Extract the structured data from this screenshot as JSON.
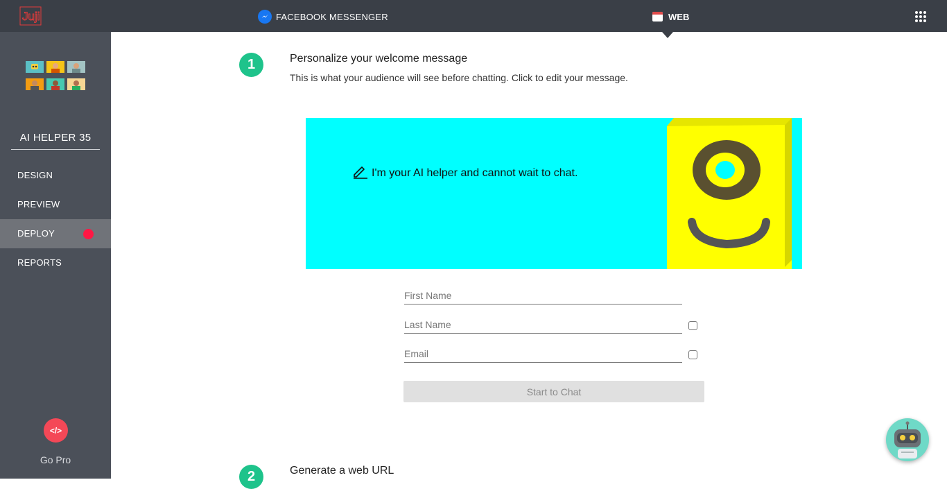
{
  "topbar": {
    "logo_text": "Juji",
    "tabs": [
      {
        "label": "FACEBOOK MESSENGER",
        "icon": "messenger-icon"
      },
      {
        "label": "WEB",
        "icon": "calendar-icon",
        "active": true
      }
    ],
    "apps_icon": "grid-icon"
  },
  "sidebar": {
    "bot_name": "AI HELPER 35",
    "items": [
      {
        "label": "DESIGN"
      },
      {
        "label": "PREVIEW"
      },
      {
        "label": "DEPLOY",
        "active": true,
        "status": "red-dot"
      },
      {
        "label": "REPORTS"
      }
    ],
    "gopro": {
      "icon_text": "</>",
      "label": "Go Pro"
    }
  },
  "main": {
    "step1": {
      "number": "1",
      "title": "Personalize your welcome message",
      "subtitle": "This is what your audience will see before chatting. Click to edit your message."
    },
    "banner": {
      "message": "I'm your AI helper and cannot wait to chat.",
      "background": "#00ffff",
      "robot_color": "#ffff00"
    },
    "form": {
      "first_name_placeholder": "First Name",
      "last_name_placeholder": "Last Name",
      "email_placeholder": "Email",
      "start_button": "Start to Chat"
    },
    "step2": {
      "number": "2",
      "title": "Generate a web URL"
    }
  },
  "colors": {
    "topbar": "#3a3f47",
    "sidebar": "#4b5059",
    "accent_green": "#1ec38b",
    "deploy_dot": "#ff1744",
    "gopro": "#f44857"
  }
}
